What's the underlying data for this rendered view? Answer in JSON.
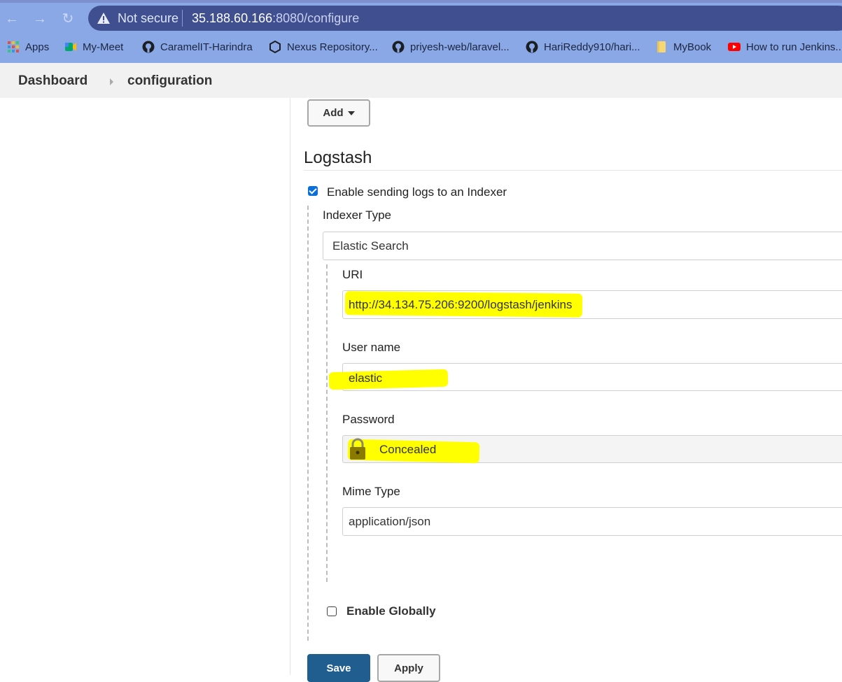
{
  "browser": {
    "nav": {
      "back": "←",
      "forward": "→",
      "reload": "↻"
    },
    "security_label": "Not secure",
    "url_host": "35.188.60.166",
    "url_rest": ":8080/configure"
  },
  "bookmarks": [
    {
      "label": "Apps",
      "icon": "apps-grid-icon"
    },
    {
      "label": "My-Meet",
      "icon": "meet-icon"
    },
    {
      "label": "CaramelIT-Harindra",
      "icon": "github-icon"
    },
    {
      "label": "Nexus Repository...",
      "icon": "nexus-icon"
    },
    {
      "label": "priyesh-web/laravel...",
      "icon": "github-icon"
    },
    {
      "label": "HariReddy910/hari...",
      "icon": "github-icon"
    },
    {
      "label": "MyBook",
      "icon": "folder-icon"
    },
    {
      "label": "How to run Jenkins...",
      "icon": "youtube-icon"
    }
  ],
  "breadcrumb": {
    "home": "Dashboard",
    "current": "configuration"
  },
  "add_button": "Add",
  "logstash": {
    "title": "Logstash",
    "enable_label": "Enable sending logs to an Indexer",
    "enable_checked": true,
    "indexer_type_label": "Indexer Type",
    "indexer_type_value": "Elastic Search",
    "uri_label": "URI",
    "uri_value": "http://34.134.75.206:9200/logstash/jenkins",
    "username_label": "User name",
    "username_value": "elastic",
    "password_label": "Password",
    "password_value": "Concealed",
    "mime_label": "Mime Type",
    "mime_value": "application/json",
    "enable_globally_label": "Enable Globally",
    "enable_globally_checked": false
  },
  "footer": {
    "save": "Save",
    "apply": "Apply"
  },
  "colors": {
    "highlight": "#ffff00",
    "primary": "#1f5e8e",
    "checkbox": "#0b6fd8",
    "lock": "#8a7a00"
  }
}
